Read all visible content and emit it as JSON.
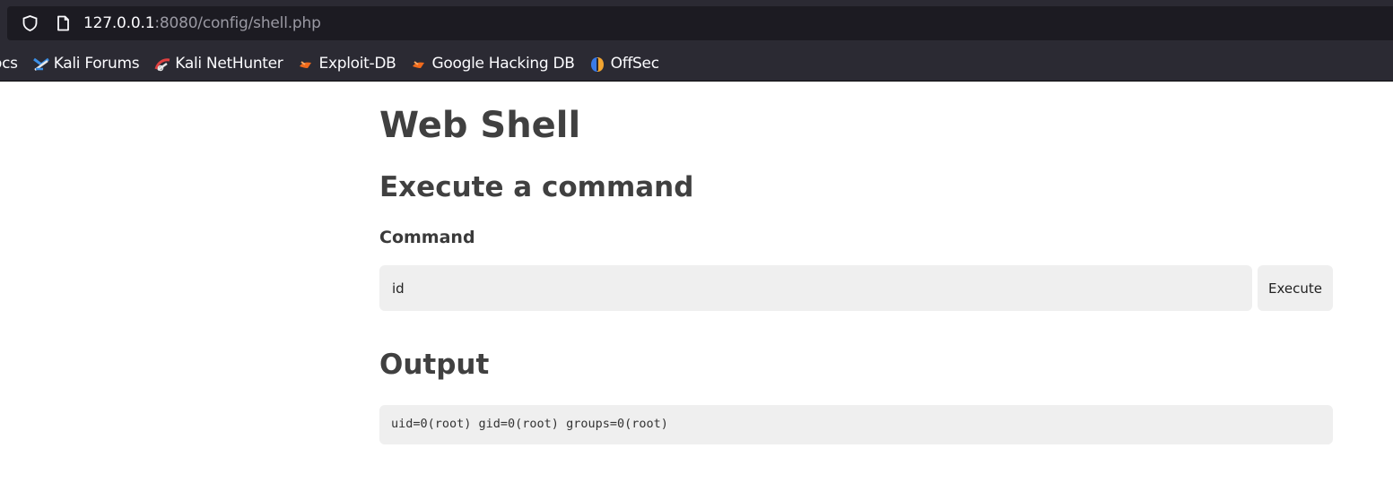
{
  "browser": {
    "url_host": "127.0.0.1",
    "url_rest": ":8080/config/shell.php",
    "bookmarks": [
      {
        "label": "ocs",
        "icon": "docs-clipped"
      },
      {
        "label": "Kali Forums",
        "icon": "kali-forums-icon"
      },
      {
        "label": "Kali NetHunter",
        "icon": "kali-nethunter-icon"
      },
      {
        "label": "Exploit-DB",
        "icon": "exploit-db-icon"
      },
      {
        "label": "Google Hacking DB",
        "icon": "google-hacking-db-icon"
      },
      {
        "label": "OffSec",
        "icon": "offsec-icon"
      }
    ]
  },
  "page": {
    "title": "Web Shell",
    "section_execute": "Execute a command",
    "command_label": "Command",
    "command_value": "id",
    "execute_button": "Execute",
    "section_output": "Output",
    "output_text": "uid=0(root) gid=0(root) groups=0(root)"
  },
  "colors": {
    "chrome_bg": "#2b2a33",
    "urlbar_bg": "#1c1b22",
    "input_bg": "#efefef",
    "heading_text": "#404040"
  }
}
